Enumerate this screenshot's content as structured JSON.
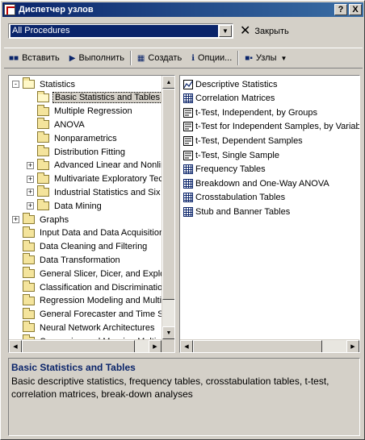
{
  "window": {
    "title": "Диспетчер узлов",
    "help_label": "?",
    "close_label": "X"
  },
  "selector": {
    "value": "All Procedures",
    "close_label": "Закрыть"
  },
  "toolbar": {
    "insert_label": "Вставить",
    "run_label": "Выполнить",
    "create_label": "Создать",
    "options_label": "Опции...",
    "nodes_label": "Узлы"
  },
  "tree": {
    "items": [
      {
        "label": "Statistics",
        "expander": "-",
        "level": 0,
        "open": true
      },
      {
        "label": "Basic Statistics and Tables",
        "expander": "",
        "level": 1,
        "open": true,
        "selected": true
      },
      {
        "label": "Multiple Regression",
        "expander": "",
        "level": 1
      },
      {
        "label": "ANOVA",
        "expander": "",
        "level": 1
      },
      {
        "label": "Nonparametrics",
        "expander": "",
        "level": 1
      },
      {
        "label": "Distribution Fitting",
        "expander": "",
        "level": 1
      },
      {
        "label": "Advanced Linear and Nonline",
        "expander": "+",
        "level": 1
      },
      {
        "label": "Multivariate Exploratory Techn",
        "expander": "+",
        "level": 1
      },
      {
        "label": "Industrial Statistics and Six Sig",
        "expander": "+",
        "level": 1
      },
      {
        "label": "Data Mining",
        "expander": "+",
        "level": 1
      },
      {
        "label": "Graphs",
        "expander": "+",
        "level": 0
      },
      {
        "label": "Input Data and Data Acquisition",
        "expander": "",
        "level": 0
      },
      {
        "label": "Data Cleaning and Filtering",
        "expander": "",
        "level": 0
      },
      {
        "label": "Data Transformation",
        "expander": "",
        "level": 0
      },
      {
        "label": "General Slicer, Dicer, and Explore",
        "expander": "",
        "level": 0
      },
      {
        "label": "Classification and Discrimination",
        "expander": "",
        "level": 0
      },
      {
        "label": "Regression Modeling and Multivar",
        "expander": "",
        "level": 0
      },
      {
        "label": "General Forecaster and Time Seri",
        "expander": "",
        "level": 0
      },
      {
        "label": "Neural Network Architectures",
        "expander": "",
        "level": 0
      },
      {
        "label": "Comparing and Merging Multiple D",
        "expander": "",
        "level": 0
      }
    ]
  },
  "procedures": {
    "items": [
      {
        "label": "Descriptive Statistics",
        "icon": "chart-icon"
      },
      {
        "label": "Correlation Matrices",
        "icon": "grid-icon"
      },
      {
        "label": "t-Test, Independent, by Groups",
        "icon": "ttest-icon"
      },
      {
        "label": "t-Test for Independent Samples, by Variables",
        "icon": "ttest-icon"
      },
      {
        "label": "t-Test, Dependent Samples",
        "icon": "ttest-icon"
      },
      {
        "label": "t-Test, Single Sample",
        "icon": "ttest-single-icon"
      },
      {
        "label": "Frequency Tables",
        "icon": "table-icon"
      },
      {
        "label": "Breakdown and One-Way ANOVA",
        "icon": "table-icon"
      },
      {
        "label": "Crosstabulation Tables",
        "icon": "table-icon"
      },
      {
        "label": "Stub and Banner Tables",
        "icon": "table-icon"
      }
    ]
  },
  "description": {
    "title": "Basic Statistics and Tables",
    "text": "Basic descriptive statistics, frequency tables, crosstabulation tables, t-test, correlation matrices, break-down analyses"
  },
  "colors": {
    "title_bar": "#0a246a",
    "selection": "#0a246a",
    "face": "#d4d0c8",
    "folder": "#f4e49c"
  }
}
